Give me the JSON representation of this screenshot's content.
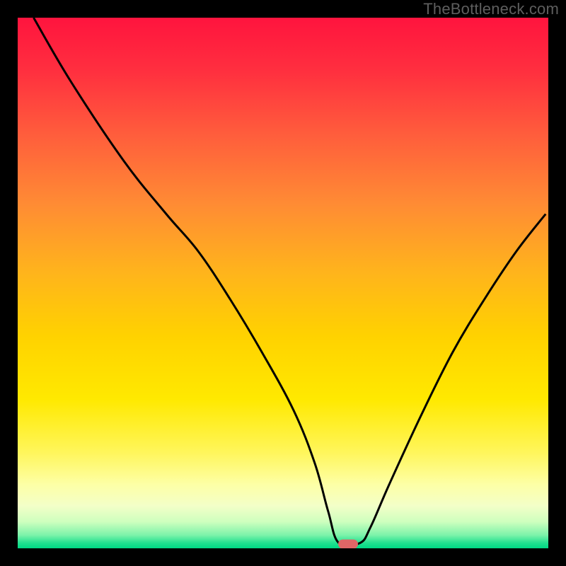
{
  "watermark": "TheBottleneck.com",
  "marker": {
    "color": "#e06666",
    "x_pct": 62.2,
    "y_pct": 99.2
  },
  "gradient_stops": [
    {
      "offset": 0.0,
      "color": "#ff143e"
    },
    {
      "offset": 0.1,
      "color": "#ff2f3f"
    },
    {
      "offset": 0.22,
      "color": "#ff5d3c"
    },
    {
      "offset": 0.35,
      "color": "#ff8b34"
    },
    {
      "offset": 0.48,
      "color": "#ffb41c"
    },
    {
      "offset": 0.6,
      "color": "#ffd200"
    },
    {
      "offset": 0.72,
      "color": "#ffe900"
    },
    {
      "offset": 0.82,
      "color": "#fff65c"
    },
    {
      "offset": 0.88,
      "color": "#fdffa6"
    },
    {
      "offset": 0.92,
      "color": "#f3ffc8"
    },
    {
      "offset": 0.95,
      "color": "#ceffbe"
    },
    {
      "offset": 0.975,
      "color": "#7df3aa"
    },
    {
      "offset": 0.99,
      "color": "#21e08f"
    },
    {
      "offset": 1.0,
      "color": "#00d884"
    }
  ],
  "chart_data": {
    "type": "line",
    "title": "",
    "xlabel": "",
    "ylabel": "",
    "xlim": [
      0,
      100
    ],
    "ylim": [
      0,
      100
    ],
    "grid": false,
    "legend": false,
    "series": [
      {
        "name": "bottleneck-curve",
        "x": [
          3,
          10,
          20,
          28,
          34,
          40,
          46,
          52,
          56,
          58.5,
          60.5,
          64.5,
          66.5,
          70,
          76,
          82,
          88,
          94,
          99.5
        ],
        "y": [
          100,
          88,
          73,
          63,
          56,
          47,
          37,
          26,
          16,
          7,
          1,
          1,
          4,
          12,
          25,
          37,
          47,
          56,
          63
        ]
      }
    ],
    "marker_point": {
      "x": 62.2,
      "y": 0.8
    },
    "notes": "x and y are percentages of the plot area (0 = left/bottom, 100 = right/top). Values estimated by eye; the curve descends from near top-left, reaches ~0 at x≈60–65 where a red pill marker sits, then rises towards the right edge."
  }
}
